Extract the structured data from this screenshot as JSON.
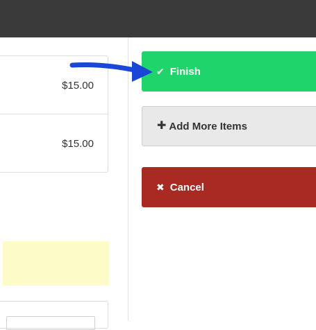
{
  "items": [
    {
      "price": "$15.00"
    },
    {
      "price": "$15.00"
    }
  ],
  "actions": {
    "finish": {
      "label": "Finish",
      "icon": "check-icon"
    },
    "add_more": {
      "label": "Add More Items",
      "icon": "plus-icon"
    },
    "cancel": {
      "label": "Cancel",
      "icon": "close-icon"
    }
  },
  "colors": {
    "topbar": "#3a3a3a",
    "finish": "#1fd46a",
    "add_more": "#e9e9e9",
    "cancel": "#a82a22",
    "notice": "#fdfbc8",
    "annotation_arrow": "#1a47d6"
  }
}
